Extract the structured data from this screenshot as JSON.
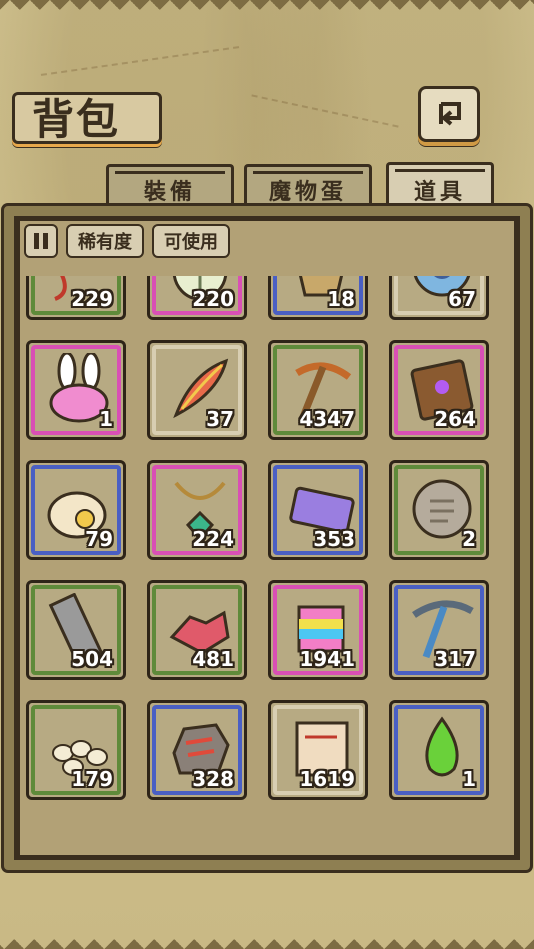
{
  "header": {
    "title": "背包"
  },
  "tabs": [
    {
      "label": "裝備",
      "active": false
    },
    {
      "label": "魔物蛋",
      "active": false
    },
    {
      "label": "道具",
      "active": true
    }
  ],
  "filters": {
    "rarity_label": "稀有度",
    "usable_label": "可使用"
  },
  "colors": {
    "common": "#5f8a3a",
    "rare": "#4a5fc4",
    "epic": "#d94fb5",
    "plain": "#d8ceb2"
  },
  "items": [
    {
      "icon": "talisman-icon",
      "count": "229",
      "rarity": "green"
    },
    {
      "icon": "lantern-icon",
      "count": "220",
      "rarity": "pink"
    },
    {
      "icon": "ore-crystal-icon",
      "count": "18",
      "rarity": "blue"
    },
    {
      "icon": "swirl-stone-icon",
      "count": "67",
      "rarity": "plain"
    },
    {
      "icon": "rabbit-hat-icon",
      "count": "1",
      "rarity": "pink"
    },
    {
      "icon": "feather-icon",
      "count": "37",
      "rarity": "plain"
    },
    {
      "icon": "pickaxe-icon",
      "count": "4347",
      "rarity": "green"
    },
    {
      "icon": "spellbook-icon",
      "count": "264",
      "rarity": "pink"
    },
    {
      "icon": "loot-bag-icon",
      "count": "79",
      "rarity": "blue"
    },
    {
      "icon": "amulet-icon",
      "count": "224",
      "rarity": "pink"
    },
    {
      "icon": "ticket-icon",
      "count": "353",
      "rarity": "blue"
    },
    {
      "icon": "stone-tablet-icon",
      "count": "2",
      "rarity": "green"
    },
    {
      "icon": "iron-ingot-icon",
      "count": "504",
      "rarity": "green"
    },
    {
      "icon": "red-crystal-icon",
      "count": "481",
      "rarity": "green"
    },
    {
      "icon": "rainbow-block-icon",
      "count": "1941",
      "rarity": "pink"
    },
    {
      "icon": "steel-pickaxe-icon",
      "count": "317",
      "rarity": "blue"
    },
    {
      "icon": "eggs-icon",
      "count": "179",
      "rarity": "green"
    },
    {
      "icon": "ore-rock-icon",
      "count": "328",
      "rarity": "blue"
    },
    {
      "icon": "scroll-icon",
      "count": "1619",
      "rarity": "plain"
    },
    {
      "icon": "green-flame-icon",
      "count": "1",
      "rarity": "blue"
    }
  ]
}
